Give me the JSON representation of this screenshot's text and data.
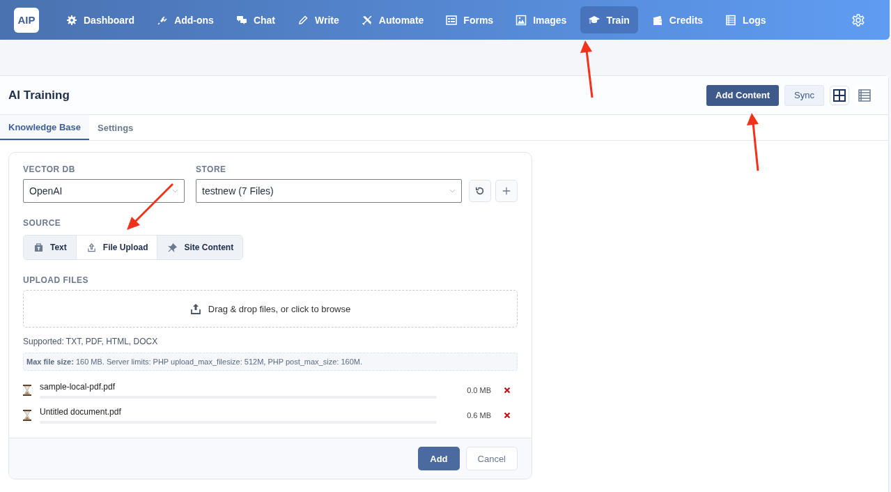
{
  "nav": {
    "logo": "AIP",
    "items": [
      {
        "label": "Dashboard",
        "selected": false
      },
      {
        "label": "Add-ons",
        "selected": false
      },
      {
        "label": "Chat",
        "selected": false
      },
      {
        "label": "Write",
        "selected": false
      },
      {
        "label": "Automate",
        "selected": false
      },
      {
        "label": "Forms",
        "selected": false
      },
      {
        "label": "Images",
        "selected": false
      },
      {
        "label": "Train",
        "selected": true
      },
      {
        "label": "Credits",
        "selected": false
      },
      {
        "label": "Logs",
        "selected": false
      }
    ]
  },
  "page": {
    "title": "AI Training",
    "actions": {
      "primary": "Add Content",
      "secondary": "Sync"
    },
    "views": [
      {
        "kind": "grid",
        "selected": true
      },
      {
        "kind": "list",
        "selected": false
      }
    ]
  },
  "tabs": [
    {
      "label": "Knowledge Base",
      "selected": true
    },
    {
      "label": "Settings",
      "selected": false
    }
  ],
  "form": {
    "vector_db": {
      "label": "VECTOR DB",
      "value": "OpenAI"
    },
    "store": {
      "label": "STORE",
      "value": "testnew (7 Files)"
    },
    "source": {
      "label": "SOURCE",
      "options": [
        {
          "label": "Text",
          "selected": false
        },
        {
          "label": "File Upload",
          "selected": true
        },
        {
          "label": "Site Content",
          "selected": false
        }
      ]
    },
    "upload": {
      "label": "UPLOAD FILES",
      "dropzone": "Drag & drop files, or click to browse",
      "supported": "Supported: TXT, PDF, HTML, DOCX",
      "limits": "**Max file size:** 160 MB. Server limits: PHP upload_max_filesize: 512M, PHP post_max_size: 160M.",
      "files": [
        {
          "name": "sample-local-pdf.pdf",
          "size": "0.0 MB",
          "level": 0
        },
        {
          "name": "Untitled document.pdf",
          "size": "0.6 MB",
          "level": 0
        }
      ]
    },
    "buttons": {
      "submit": "Add",
      "cancel": "Cancel"
    }
  }
}
